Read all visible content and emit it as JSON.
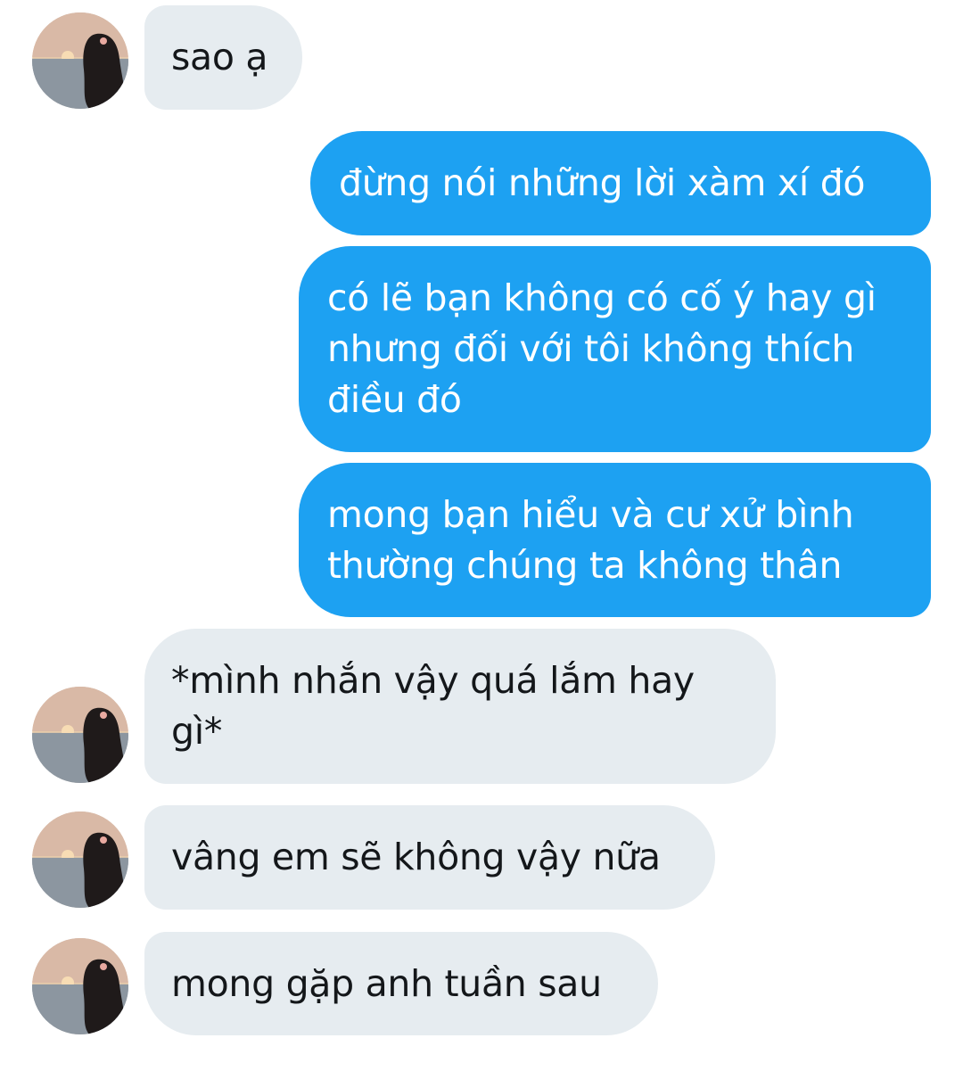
{
  "conversation": {
    "messages": [
      {
        "from": "them",
        "lines": [
          "sao ạ"
        ]
      },
      {
        "from": "me",
        "lines": [
          "đừng nói những lời xàm xí đó"
        ]
      },
      {
        "from": "me",
        "lines": [
          "có lẽ bạn không có cố ý hay gì",
          "nhưng đối với tôi không thích",
          "điều đó"
        ]
      },
      {
        "from": "me",
        "lines": [
          "mong bạn hiểu và cư xử bình",
          "thường chúng ta không thân"
        ]
      },
      {
        "from": "them",
        "lines": [
          "*mình nhắn vậy quá lắm hay",
          "gì*"
        ]
      },
      {
        "from": "them",
        "lines": [
          "vâng em sẽ không vậy nữa"
        ]
      },
      {
        "from": "them",
        "lines": [
          "mong gặp anh tuần sau"
        ]
      }
    ],
    "avatar": {
      "icon": "profile-photo-avatar"
    }
  },
  "colors": {
    "incoming_bubble": "#e6ecf0",
    "outgoing_bubble": "#1da1f2",
    "incoming_text": "#14171a",
    "outgoing_text": "#ffffff"
  }
}
